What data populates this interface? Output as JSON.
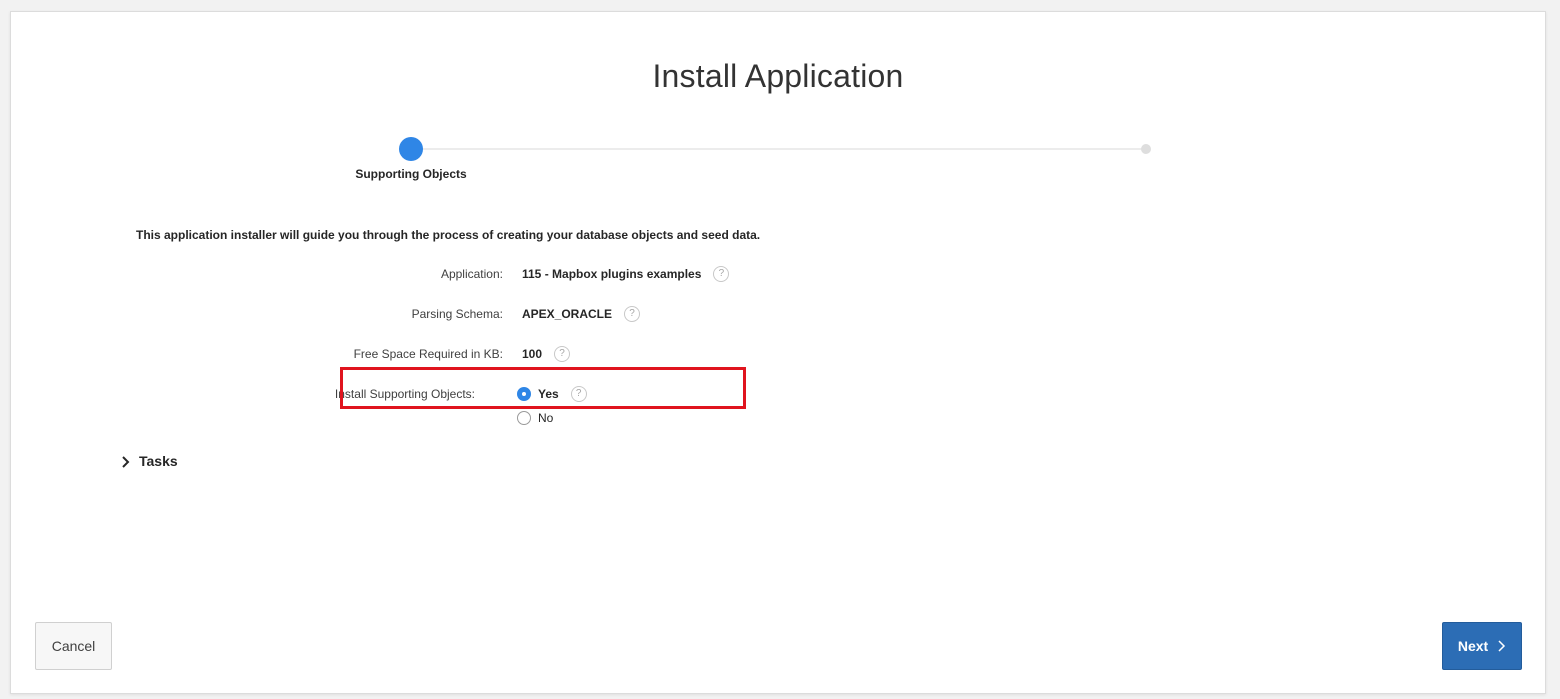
{
  "dialog": {
    "title": "Install Application"
  },
  "wizard": {
    "current_step_label": "Supporting Objects"
  },
  "intro_text": "This application installer will guide you through the process of creating your database objects and seed data.",
  "fields": {
    "application": {
      "label": "Application:",
      "value": "115 - Mapbox plugins examples"
    },
    "parsing_schema": {
      "label": "Parsing Schema:",
      "value": "APEX_ORACLE"
    },
    "free_space": {
      "label": "Free Space Required in KB:",
      "value": "100"
    },
    "install_supporting_objects": {
      "label": "Install Supporting Objects:",
      "options": [
        "Yes",
        "No"
      ],
      "selected": "Yes"
    }
  },
  "help_icon_glyph": "?",
  "tasks": {
    "label": "Tasks",
    "expanded": false
  },
  "buttons": {
    "cancel": "Cancel",
    "next": "Next"
  },
  "colors": {
    "accent": "#2f86e6",
    "primary_button": "#2c6db5",
    "highlight_border": "#e0141e"
  },
  "icons": {
    "help": "question-mark-icon",
    "tasks_toggle": "chevron-right-icon",
    "next": "chevron-right-icon"
  }
}
